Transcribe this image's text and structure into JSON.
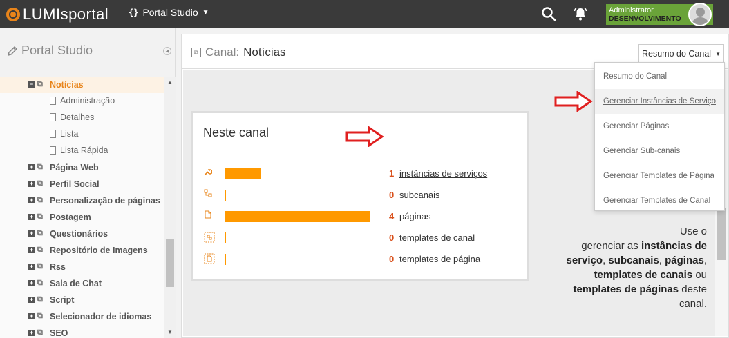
{
  "topbar": {
    "logo_prefix": "LUMI",
    "logo_suffix": "sportal",
    "studio_brace": "{}",
    "studio_label": "Portal Studio",
    "user_name": "Administrator",
    "user_env": "DESENVOLVIMENTO",
    "icons": [
      "search-icon",
      "bell-icon",
      "avatar"
    ]
  },
  "sidebar": {
    "title": "Portal Studio",
    "items": [
      {
        "label": "Notícias",
        "expander": "−",
        "active": true
      },
      {
        "label": "Administração",
        "child": true
      },
      {
        "label": "Detalhes",
        "child": true
      },
      {
        "label": "Lista",
        "child": true
      },
      {
        "label": "Lista Rápida",
        "child": true
      },
      {
        "label": "Página Web",
        "expander": "+"
      },
      {
        "label": "Perfil Social",
        "expander": "+"
      },
      {
        "label": "Personalização de páginas",
        "expander": "+"
      },
      {
        "label": "Postagem",
        "expander": "+"
      },
      {
        "label": "Questionários",
        "expander": "+"
      },
      {
        "label": "Repositório de Imagens",
        "expander": "+"
      },
      {
        "label": "Rss",
        "expander": "+"
      },
      {
        "label": "Sala de Chat",
        "expander": "+"
      },
      {
        "label": "Script",
        "expander": "+"
      },
      {
        "label": "Selecionador de idiomas",
        "expander": "+"
      },
      {
        "label": "SEO",
        "expander": "+"
      }
    ]
  },
  "main": {
    "title_prefix": "Canal:",
    "title_name": "Notícias",
    "dropdown_label": "Resumo do Canal",
    "dropdown_options": [
      "Resumo do Canal",
      "Gerenciar Instâncias de Serviço",
      "Gerenciar Páginas",
      "Gerenciar Sub-canais",
      "Gerenciar Templates de Página",
      "Gerenciar Templates de Canal"
    ],
    "panel_title": "Neste canal",
    "stats": [
      {
        "icon": "wrench-icon",
        "glyph": "🔧",
        "count": "1",
        "label": "instâncias de serviços",
        "link": true,
        "fraction": 0.25
      },
      {
        "icon": "subchannel-icon",
        "glyph": "⧉",
        "count": "0",
        "label": "subcanais",
        "link": false,
        "fraction": 0
      },
      {
        "icon": "page-icon",
        "glyph": "🗋",
        "count": "4",
        "label": "páginas",
        "link": false,
        "fraction": 1.0
      },
      {
        "icon": "channel-template-icon",
        "glyph": "⬚",
        "count": "0",
        "label": "templates de canal",
        "link": false,
        "fraction": 0
      },
      {
        "icon": "page-template-icon",
        "glyph": "⬚",
        "count": "0",
        "label": "templates de página",
        "link": false,
        "fraction": 0
      }
    ],
    "help": {
      "t1": "Use o",
      "t2": "gerenciar as",
      "b1": "instâncias de",
      "b2": "serviço",
      "t3": ",",
      "b3": "subcanais",
      "t4": ",",
      "b4": "páginas",
      "t5": ",",
      "b5": "templates de canais",
      "t6": "ou",
      "b6": "templates de páginas",
      "t7": "deste",
      "t8": "canal."
    }
  },
  "colors": {
    "accent": "#e8841a",
    "bar": "#ff9900",
    "count": "#d9501b",
    "user_badge": "#6aa339",
    "annotation_arrow": "#e02020"
  }
}
